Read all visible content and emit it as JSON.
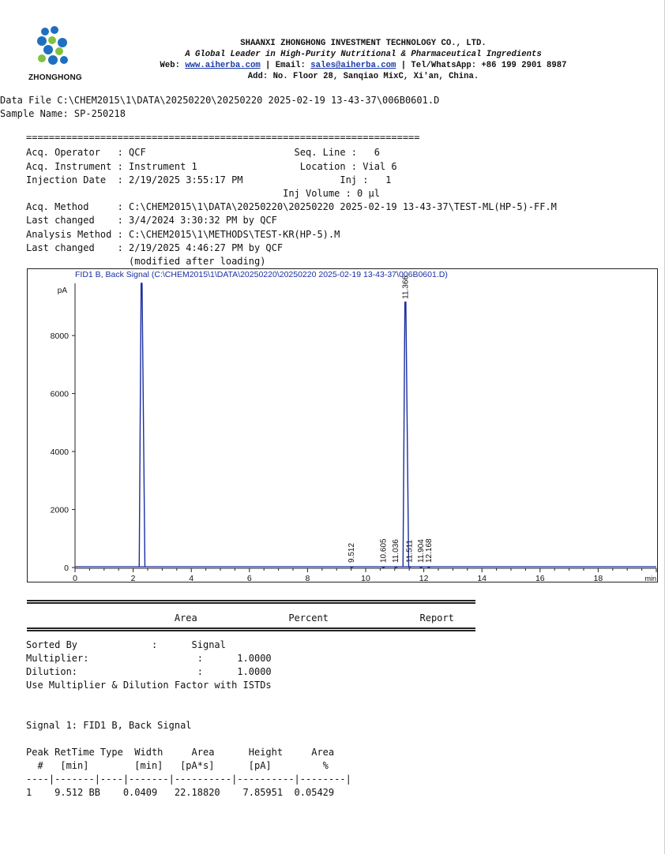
{
  "header": {
    "logo_text": "ZHONGHONG",
    "company": "SHAANXI ZHONGHONG INVESTMENT TECHNOLOGY CO., LTD.",
    "tagline": "A Global Leader in High-Purity Nutritional & Pharmaceutical Ingredients",
    "web_label": "Web:",
    "web": "www.aiherba.com",
    "email_label": "| Email:",
    "email": "sales@aiherba.com",
    "tel": "| Tel/WhatsApp: +86 199 2901 8987",
    "address": "Add: No. Floor 28, Sanqiao MixC, Xi'an, China."
  },
  "file": {
    "data_file": "Data File C:\\CHEM2015\\1\\DATA\\20250220\\20250220 2025-02-19 13-43-37\\006B0601.D",
    "sample_name": "Sample Name: SP-250218"
  },
  "separator": "=====================================================================",
  "acq": {
    "operator": "Acq. Operator   : QCF                          Seq. Line :   6",
    "instrument": "Acq. Instrument : Instrument 1                  Location : Vial 6",
    "injection_date": "Injection Date  : 2/19/2025 3:55:17 PM                 Inj :   1",
    "inj_volume": "                                             Inj Volume : 0 µl",
    "method": "Acq. Method     : C:\\CHEM2015\\1\\DATA\\20250220\\20250220 2025-02-19 13-43-37\\TEST-ML(HP-5)-FF.M",
    "last_changed_1": "Last changed    : 3/4/2024 3:30:32 PM by QCF",
    "analysis_method": "Analysis Method : C:\\CHEM2015\\1\\METHODS\\TEST-KR(HP-5).M",
    "last_changed_2": "Last changed    : 2/19/2025 4:46:27 PM by QCF",
    "modified": "                  (modified after loading)"
  },
  "chart_data": {
    "type": "line",
    "title": "FID1 B, Back Signal (C:\\CHEM2015\\1\\DATA\\20250220\\20250220 2025-02-19 13-43-37\\006B0601.D)",
    "ylabel": "pA",
    "xlabel": "min",
    "xlim": [
      0,
      20
    ],
    "ylim": [
      -50,
      9800
    ],
    "x_ticks": [
      0,
      2,
      4,
      6,
      8,
      10,
      12,
      14,
      16,
      18
    ],
    "y_ticks": [
      0,
      2000,
      4000,
      6000,
      8000
    ],
    "color": "#1a2ea0",
    "peaks": [
      {
        "rt": 2.29,
        "height": 9800,
        "labeled": false
      },
      {
        "rt": 9.512,
        "height": 8,
        "label": "9.512"
      },
      {
        "rt": 10.605,
        "height": 5,
        "label": "10.605"
      },
      {
        "rt": 11.036,
        "height": 6,
        "label": "11.036"
      },
      {
        "rt": 11.366,
        "height": 9150,
        "label": "11.366"
      },
      {
        "rt": 11.511,
        "height": 12,
        "label": "11.511"
      },
      {
        "rt": 11.904,
        "height": 6,
        "label": "11.904"
      },
      {
        "rt": 12.168,
        "height": 5,
        "label": "12.168"
      }
    ]
  },
  "report": {
    "title": "                          Area                Percent                Report",
    "sorted_by": "Sorted By             :      Signal",
    "multiplier": "Multiplier:                   :      1.0000",
    "dilution": "Dilution:                     :      1.0000",
    "use_line": "Use Multiplier & Dilution Factor with ISTDs",
    "signal": "Signal 1: FID1 B, Back Signal",
    "col_header_1": "Peak RetTime Type  Width     Area      Height     Area",
    "col_header_2": "  #   [min]        [min]   [pA*s]      [pA]         %",
    "col_rule": "----|-------|----|-------|----------|----------|--------|",
    "rows": [
      "1    9.512 BB    0.0409   22.18820    7.85951  0.05429"
    ]
  }
}
